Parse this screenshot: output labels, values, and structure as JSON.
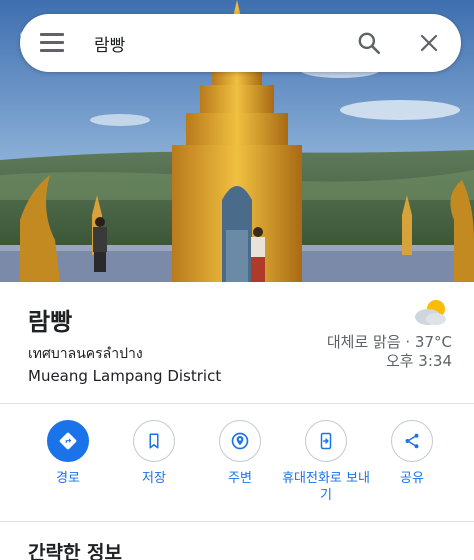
{
  "search": {
    "query": "람빵"
  },
  "place": {
    "name": "람빵",
    "local_name": "เทศบาลนครลำปาง",
    "district": "Mueang Lampang District"
  },
  "weather": {
    "icon": "partly-cloudy-icon",
    "description": "대체로 맑음 · 37°C",
    "time": "오후 3:34"
  },
  "actions": [
    {
      "label": "경로",
      "icon": "directions-icon"
    },
    {
      "label": "저장",
      "icon": "bookmark-icon"
    },
    {
      "label": "주변",
      "icon": "nearby-icon"
    },
    {
      "label": "휴대전화로 보내기",
      "icon": "send-to-phone-icon"
    },
    {
      "label": "공유",
      "icon": "share-icon"
    }
  ],
  "sections": {
    "overview_title": "간략한 정보"
  },
  "colors": {
    "accent": "#1a73e8",
    "text_primary": "#202124",
    "text_secondary": "#5f6368"
  }
}
